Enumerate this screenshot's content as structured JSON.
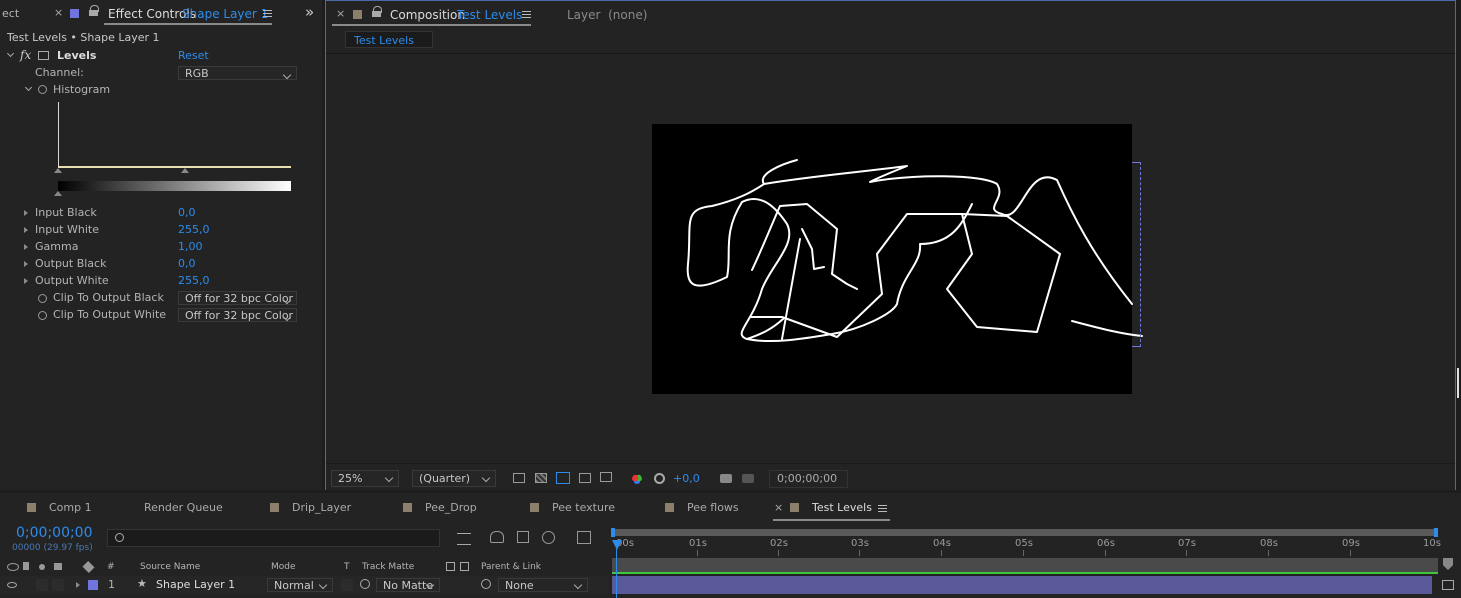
{
  "effect_panel": {
    "left_tab_fragment": "ect",
    "tab_label": "Effect Controls",
    "tab_layer": "Shape Layer 1",
    "breadcrumb": "Test Levels • Shape Layer 1",
    "effect_name": "Levels",
    "reset_label": "Reset",
    "channel_label": "Channel:",
    "channel_value": "RGB",
    "histogram_label": "Histogram",
    "properties": [
      {
        "label": "Input Black",
        "value": "0,0"
      },
      {
        "label": "Input White",
        "value": "255,0"
      },
      {
        "label": "Gamma",
        "value": "1,00"
      },
      {
        "label": "Output Black",
        "value": "0,0"
      },
      {
        "label": "Output White",
        "value": "255,0"
      }
    ],
    "clip_black_label": "Clip To Output Black",
    "clip_black_value": "Off for 32 bpc Color",
    "clip_white_label": "Clip To Output White",
    "clip_white_value": "Off for 32 bpc Color",
    "expand_panels_glyph": "»"
  },
  "comp_panel": {
    "tab_prefix": "Composition",
    "tab_comp": "Test Levels",
    "layer_tab": "Layer  (none)",
    "subtab": "Test Levels",
    "zoom": "25%",
    "resolution": "(Quarter)",
    "exposure": "+0,0",
    "timecode": "0;00;00;00"
  },
  "timeline": {
    "tabs": [
      "Comp 1",
      "Render Queue",
      "Drip_Layer",
      "Pee_Drop",
      "Pee texture",
      "Pee flows",
      "Test Levels"
    ],
    "current_time": "0;00;00;00",
    "frame_info": "00000 (29.97 fps)",
    "search_placeholder": "",
    "col_hash": "#",
    "col_source": "Source Name",
    "col_mode": "Mode",
    "col_t": "T",
    "col_track_matte": "Track Matte",
    "col_parent": "Parent & Link",
    "layer_num": "1",
    "layer_name": "Shape Layer 1",
    "layer_mode": "Normal",
    "layer_matte": "No Matte",
    "layer_parent": "None",
    "ruler": [
      "00s",
      "01s",
      "02s",
      "03s",
      "04s",
      "05s",
      "06s",
      "07s",
      "08s",
      "09s",
      "10s"
    ]
  },
  "colors": {
    "accent_blue": "#2d8ceb",
    "label_purple": "#6f75dd",
    "work_area_green": "#3cc83c",
    "layer_bar": "#5a5a9a"
  }
}
